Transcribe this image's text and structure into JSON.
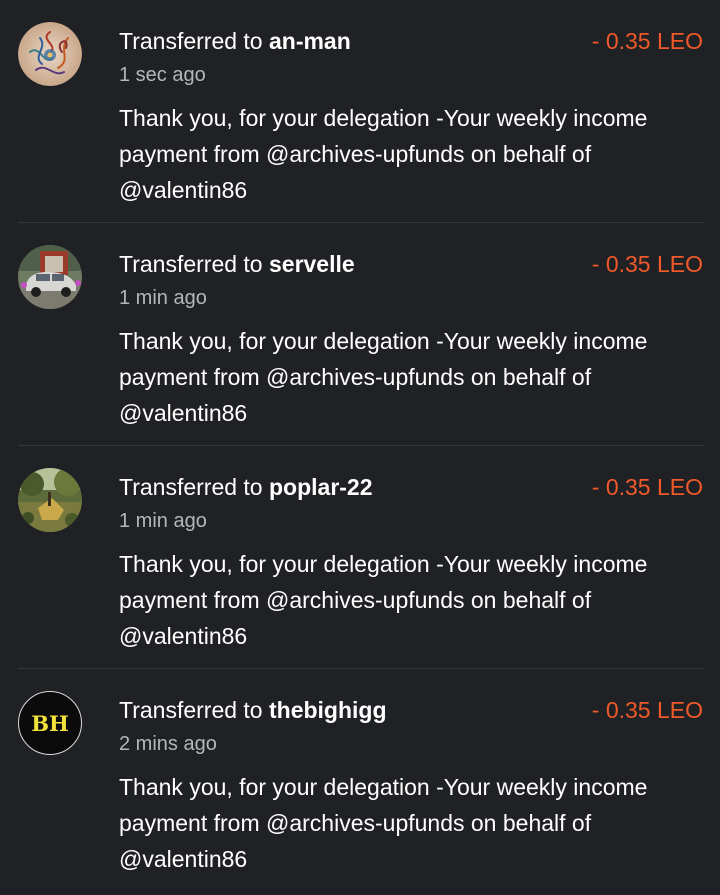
{
  "transfers": [
    {
      "prefix": "Transferred to",
      "user": "an-man",
      "amount": "- 0.35 LEO",
      "time": "1 sec ago",
      "memo": "Thank you, for your delegation -Your weekly income payment from @archives-upfunds on behalf of @valentin86",
      "avatar_icon": "mandala-art-avatar"
    },
    {
      "prefix": "Transferred to",
      "user": "servelle",
      "amount": "- 0.35 LEO",
      "time": "1 min ago",
      "memo": "Thank you, for your delegation -Your weekly income payment from @archives-upfunds on behalf of @valentin86",
      "avatar_icon": "vintage-car-photo-avatar"
    },
    {
      "prefix": "Transferred to",
      "user": "poplar-22",
      "amount": "- 0.35 LEO",
      "time": "1 min ago",
      "memo": "Thank you, for your delegation -Your weekly income payment from @archives-upfunds on behalf of @valentin86",
      "avatar_icon": "landscape-photo-avatar"
    },
    {
      "prefix": "Transferred to",
      "user": "thebighigg",
      "amount": "- 0.35 LEO",
      "time": "2 mins ago",
      "memo": "Thank you, for your delegation -Your weekly income payment from @archives-upfunds on behalf of @valentin86",
      "avatar_icon": "initials-avatar",
      "avatar_initials": "BH"
    }
  ],
  "colors": {
    "background": "#1f2124",
    "divider": "#34373b",
    "amount": "#f0592a",
    "secondary_text": "#b4b6ba",
    "initials": "#f4e23c"
  }
}
